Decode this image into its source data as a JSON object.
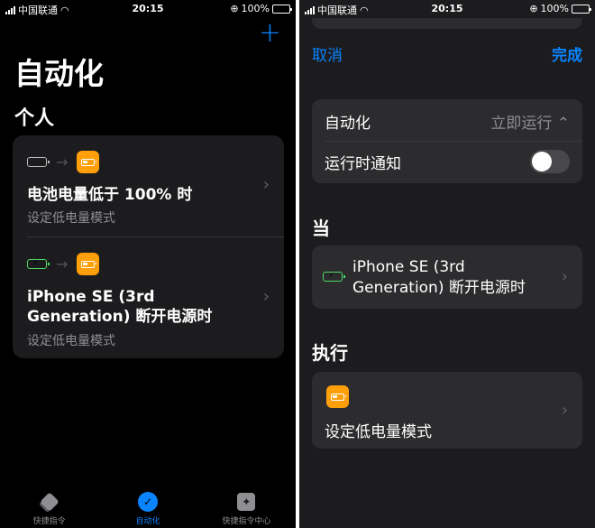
{
  "status": {
    "carrier": "中国联通",
    "time": "20:15",
    "battery": "100%"
  },
  "left": {
    "add_label": "+",
    "title": "自动化",
    "section": "个人",
    "automations": [
      {
        "title": "电池电量低于 100% 时",
        "subtitle": "设定低电量模式",
        "trigger_icon": "battery-full-icon"
      },
      {
        "title": "iPhone SE (3rd Generation) 断开电源时",
        "subtitle": "设定低电量模式",
        "trigger_icon": "battery-charging-icon"
      }
    ],
    "tabs": [
      {
        "label": "快捷指令",
        "icon": "layers-icon",
        "active": false
      },
      {
        "label": "自动化",
        "icon": "clock-check-icon",
        "active": true
      },
      {
        "label": "快捷指令中心",
        "icon": "gallery-icon",
        "active": false
      }
    ]
  },
  "right": {
    "cancel": "取消",
    "done": "完成",
    "automation_label": "自动化",
    "automation_value": "立即运行",
    "notify_label": "运行时通知",
    "notify_on": false,
    "when_header": "当",
    "trigger_text": "iPhone SE (3rd Generation) 断开电源时",
    "do_header": "执行",
    "action_text": "设定低电量模式"
  },
  "colors": {
    "accent": "#0a84ff",
    "app_orange": "#ff9f0a",
    "charging_green": "#4cd964"
  }
}
